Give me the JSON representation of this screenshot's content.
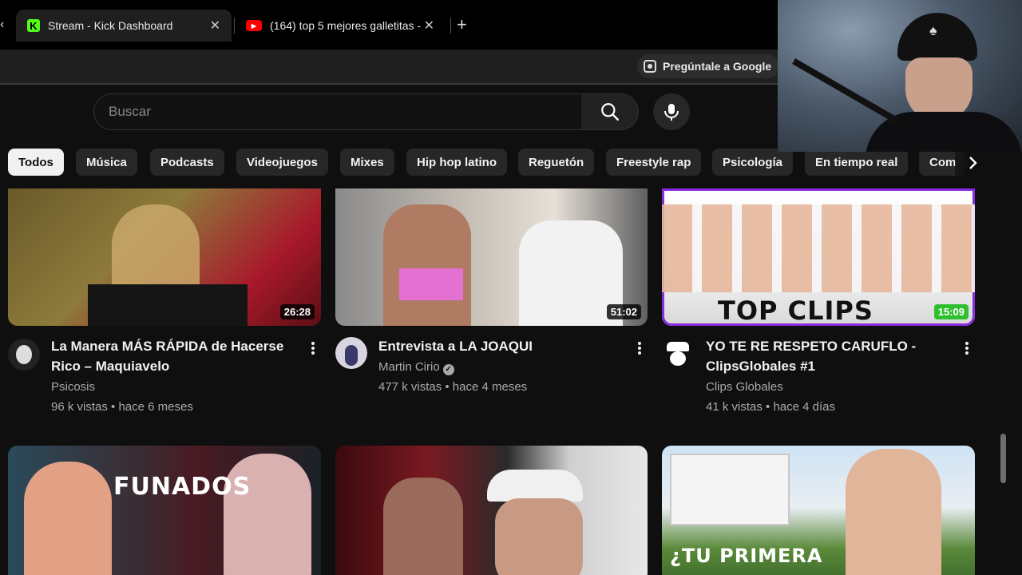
{
  "browser": {
    "tabs": [
      {
        "title": "Stream - Kick Dashboard",
        "favicon": "kick-icon",
        "active": true
      },
      {
        "title": "(164) top 5 mejores galletitas -",
        "favicon": "youtube-icon",
        "active": false
      }
    ],
    "ask_google_label": "Pregúntale a Google"
  },
  "search": {
    "placeholder": "Buscar",
    "value": ""
  },
  "chips": [
    "Todos",
    "Música",
    "Podcasts",
    "Videojuegos",
    "Mixes",
    "Hip hop latino",
    "Reguetón",
    "Freestyle rap",
    "Psicología",
    "En tiempo real",
    "Com"
  ],
  "videos": [
    {
      "title_line1": "La Manera MÁS RÁPIDA de Hacerse",
      "title_line2": "Rico – Maquiavelo",
      "channel": "Psicosis",
      "meta": "96 k vistas • hace 6 meses",
      "duration": "26:28",
      "verified": false
    },
    {
      "title_line1": "Entrevista a LA JOAQUI",
      "title_line2": "",
      "channel": "Martin Cirio",
      "meta": "477 k vistas • hace 4 meses",
      "duration": "51:02",
      "verified": true
    },
    {
      "title_line1": "YO TE RE RESPETO CARUFLO -",
      "title_line2": "ClipsGlobales #1",
      "channel": "Clips Globales",
      "meta": "41 k vistas • hace 4 días",
      "duration": "15:09",
      "verified": false,
      "thumb_text": "TOP CLIPS"
    },
    {
      "thumb_text": "FUNADOS"
    },
    {},
    {
      "thumb_text": "¿TU PRIMERA"
    }
  ],
  "colors": {
    "background": "#0f0f0f",
    "chip": "#272727",
    "chip_selected": "#f1f1f1",
    "meta_text": "#aaaaaa",
    "kick_green": "#53fc18",
    "youtube_red": "#ff0000"
  }
}
